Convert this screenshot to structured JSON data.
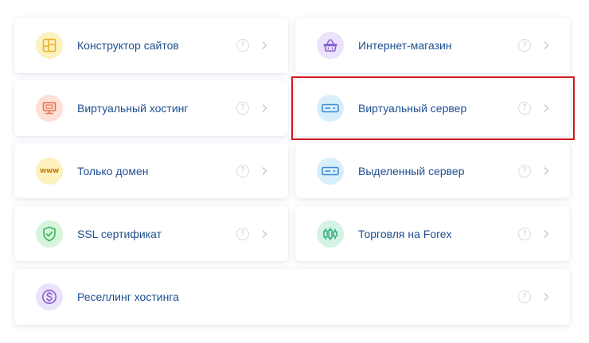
{
  "services": [
    {
      "id": "site-builder",
      "label": "Конструктор сайтов",
      "icon": "site-builder-icon",
      "circle_color": "#fdf1bf",
      "icon_color": "#e9b22b"
    },
    {
      "id": "online-store",
      "label": "Интернет-магазин",
      "icon": "basket-icon",
      "circle_color": "#ebe2fb",
      "icon_color": "#8a63d2"
    },
    {
      "id": "virtual-hosting",
      "label": "Виртуальный хостинг",
      "icon": "monitor-icon",
      "circle_color": "#fde0d6",
      "icon_color": "#ea6f4a"
    },
    {
      "id": "virtual-server",
      "label": "Виртуальный сервер",
      "icon": "server-icon",
      "circle_color": "#d8eefb",
      "icon_color": "#3e8bd0"
    },
    {
      "id": "domain-only",
      "label": "Только домен",
      "icon": "www-icon",
      "icon_text": "www",
      "circle_color": "#fdf1bf",
      "icon_color": "#c97a12"
    },
    {
      "id": "dedicated-server",
      "label": "Выделенный сервер",
      "icon": "server-icon",
      "circle_color": "#d8eefb",
      "icon_color": "#3e8bd0"
    },
    {
      "id": "ssl-certificate",
      "label": "SSL сертификат",
      "icon": "shield-check-icon",
      "circle_color": "#d6f5dc",
      "icon_color": "#3cb45a"
    },
    {
      "id": "forex",
      "label": "Торговля на Forex",
      "icon": "candlestick-icon",
      "circle_color": "#d3f3e5",
      "icon_color": "#26a86e"
    },
    {
      "id": "hosting-reselling",
      "label": "Реселлинг хостинга",
      "icon": "dollar-circle-icon",
      "circle_color": "#ebe2fb",
      "icon_color": "#8a63d2"
    }
  ],
  "help_glyph": "?",
  "selected_service": "virtual-server",
  "colors": {
    "label": "#1d4f91",
    "help": "#c9d1dc",
    "chevron": "#c4ccd7",
    "highlight": "#d0171c"
  }
}
